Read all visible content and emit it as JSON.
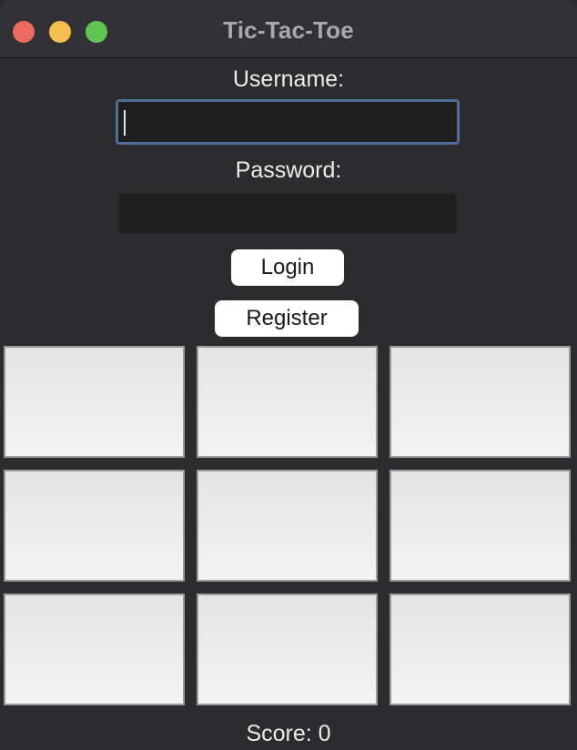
{
  "window": {
    "title": "Tic-Tac-Toe"
  },
  "login_form": {
    "username_label": "Username:",
    "username_value": "",
    "password_label": "Password:",
    "password_value": "",
    "login_label": "Login",
    "register_label": "Register"
  },
  "board": {
    "cells": [
      "",
      "",
      "",
      "",
      "",
      "",
      "",
      "",
      ""
    ]
  },
  "score": {
    "text": "Score: 0"
  },
  "colors": {
    "window_bg": "#2c2c2e",
    "titlebar_bg": "#323236",
    "focus_ring": "#4f6d96",
    "close": "#ed6a5e",
    "minimize": "#f5bf4f",
    "zoom": "#61c554"
  }
}
